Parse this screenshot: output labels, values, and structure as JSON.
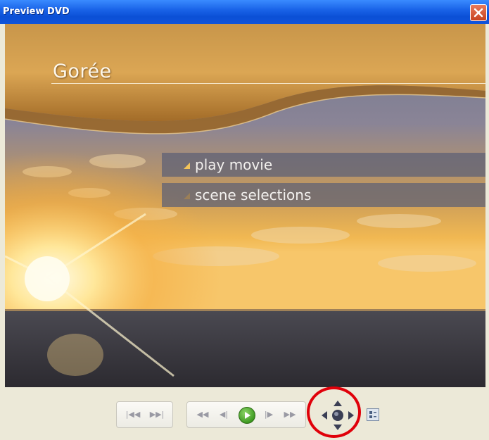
{
  "window": {
    "title": "Preview DVD"
  },
  "dvd_menu": {
    "title": "Gorée",
    "items": [
      {
        "label": "play movie"
      },
      {
        "label": "scene selections"
      }
    ]
  },
  "controls": {
    "skip_back_label": "|◀◀",
    "skip_forward_label": "▶▶|",
    "rewind_label": "◀◀",
    "step_back_label": "◀|",
    "step_forward_label": "|▶",
    "fast_forward_label": "▶▶",
    "play_icon": "play-icon",
    "navigation_icon": "navigation-pad-icon",
    "menu_icon": "dvd-menu-icon"
  },
  "colors": {
    "titlebar": "#0b4fd6",
    "highlight_circle": "#e0000a",
    "play_button": "#3f9b22"
  }
}
